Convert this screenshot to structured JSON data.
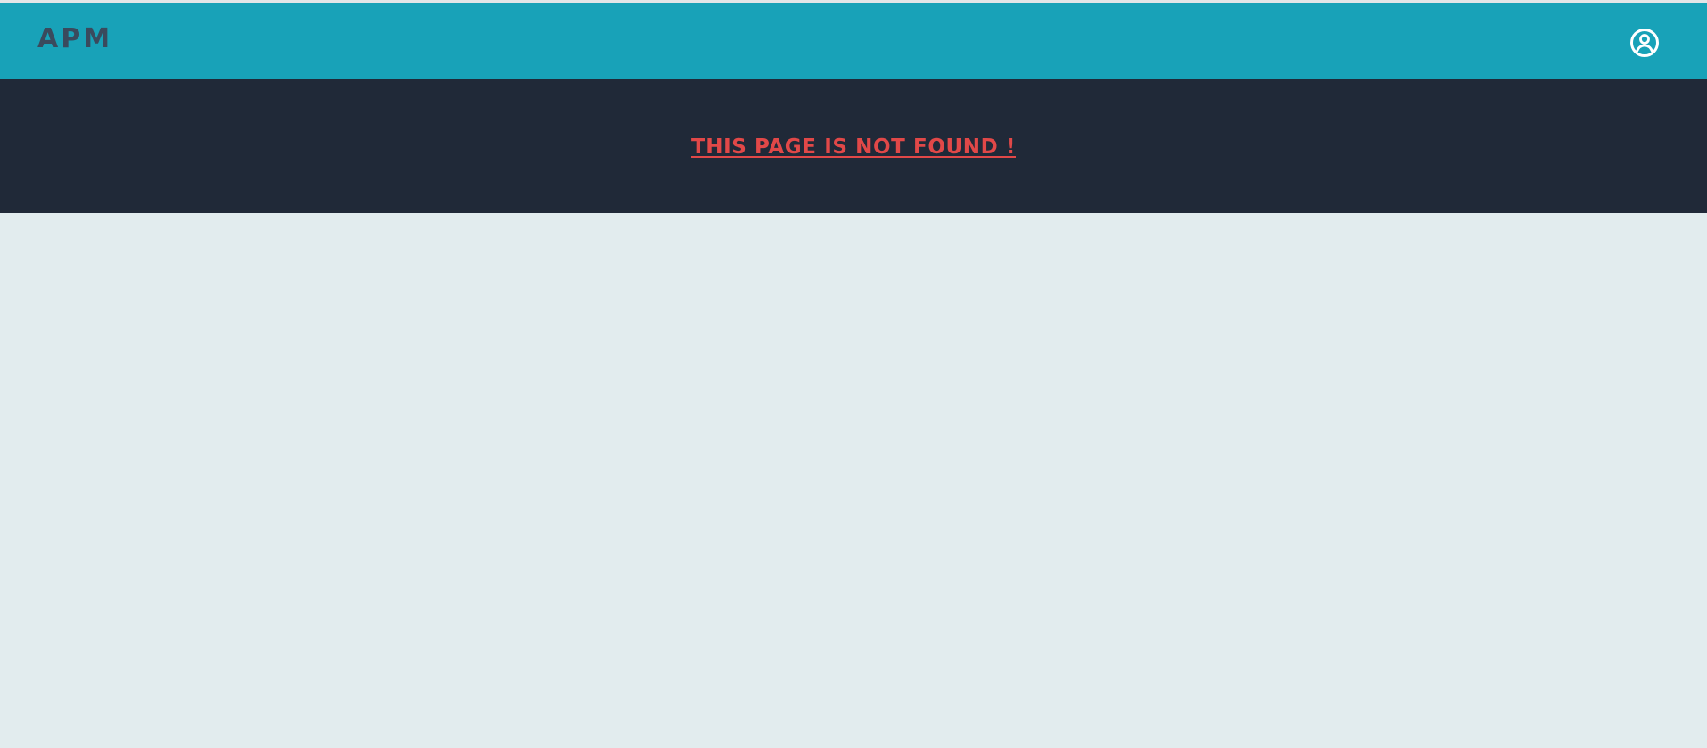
{
  "header": {
    "brand": "APM",
    "account_icon": "user-circle-icon"
  },
  "banner": {
    "message": "THIS PAGE IS NOT FOUND !"
  },
  "colors": {
    "header_bg": "#18a2b8",
    "brand_text": "#3a4a5d",
    "banner_bg": "#202938",
    "message_text": "#e14848",
    "page_bg": "#e2ecee",
    "icon": "#ffffff"
  }
}
